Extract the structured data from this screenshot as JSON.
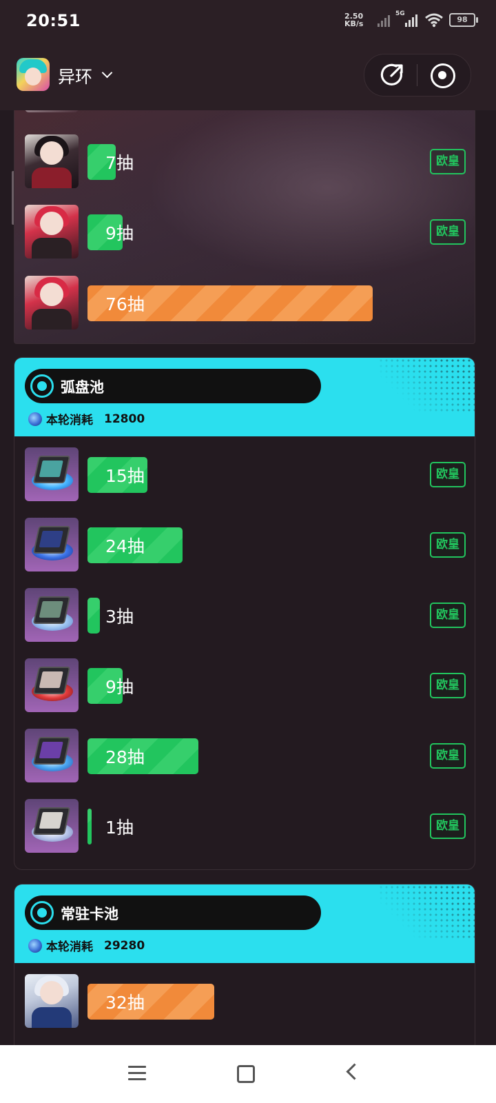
{
  "status_bar": {
    "time": "20:51",
    "net_speed_value": "2.50",
    "net_speed_unit": "KB/s",
    "network": "5G",
    "battery": "98"
  },
  "header": {
    "app_name": "异环"
  },
  "top_card": {
    "rows": [
      {
        "label": "7抽",
        "fraction": 0.09,
        "color": "green",
        "badge": "欧皇"
      },
      {
        "label": "9抽",
        "fraction": 0.11,
        "color": "green",
        "badge": "欧皇"
      },
      {
        "label": "76抽",
        "fraction": 0.9,
        "color": "orange",
        "badge": ""
      }
    ]
  },
  "pools": [
    {
      "title": "弧盘池",
      "cost_label": "本轮消耗",
      "cost_value": "12800",
      "rows": [
        {
          "label": "15抽",
          "fraction": 0.19,
          "color": "green",
          "badge": "欧皇"
        },
        {
          "label": "24抽",
          "fraction": 0.3,
          "color": "green",
          "badge": "欧皇"
        },
        {
          "label": "3抽",
          "fraction": 0.04,
          "color": "green",
          "badge": "欧皇"
        },
        {
          "label": "9抽",
          "fraction": 0.11,
          "color": "green",
          "badge": "欧皇"
        },
        {
          "label": "28抽",
          "fraction": 0.35,
          "color": "green",
          "badge": "欧皇"
        },
        {
          "label": "1抽",
          "fraction": 0.01,
          "color": "green",
          "badge": "欧皇"
        }
      ]
    },
    {
      "title": "常驻卡池",
      "cost_label": "本轮消耗",
      "cost_value": "29280",
      "rows": [
        {
          "label": "32抽",
          "fraction": 0.4,
          "color": "orange",
          "badge": ""
        }
      ]
    }
  ],
  "colors": {
    "accent_cyan": "#2bdfee",
    "green": "#22c55e",
    "orange": "#f18a3a",
    "background": "#231a20"
  }
}
